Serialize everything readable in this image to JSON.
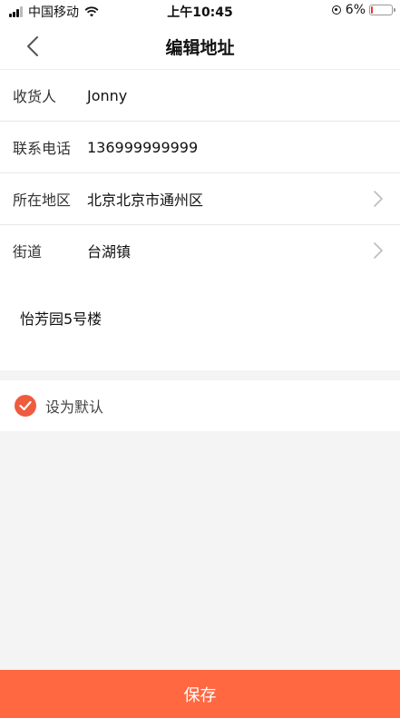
{
  "status_bar": {
    "carrier": "中国移动",
    "time": "上午10:45",
    "battery_percent": "6%",
    "battery_level": 0.06
  },
  "nav": {
    "title": "编辑地址",
    "back_icon": "chevron-left-icon"
  },
  "form": {
    "receiver_label": "收货人",
    "receiver_value": "Jonny",
    "phone_label": "联系电话",
    "phone_value": "136999999999",
    "region_label": "所在地区",
    "region_value": "北京北京市通州区",
    "street_label": "街道",
    "street_value": "台湖镇"
  },
  "detail": {
    "address_text": "怡芳园5号楼"
  },
  "default": {
    "label": "设为默认",
    "checked": true,
    "color": "#ef5b3f"
  },
  "footer": {
    "save_label": "保存",
    "color": "#ff6841"
  }
}
